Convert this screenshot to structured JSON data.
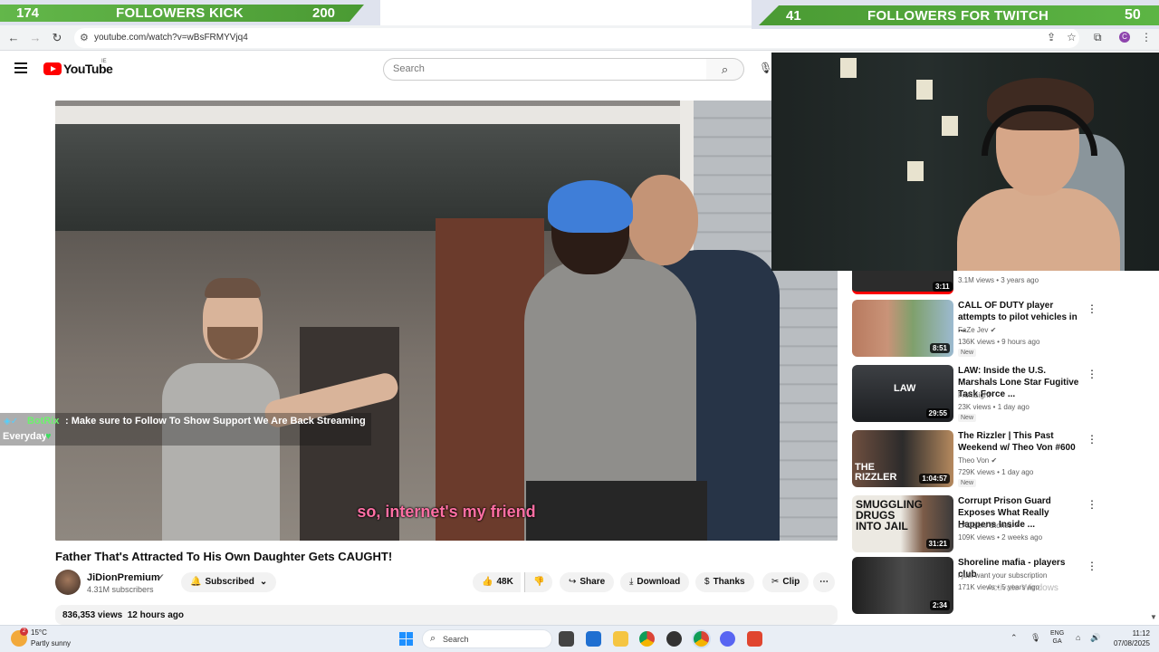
{
  "overlay": {
    "kick": {
      "left_count": "174",
      "label": "FOLLOWERS KICK",
      "right_count": "200"
    },
    "twitch": {
      "left_count": "41",
      "label": "FOLLOWERS FOR TWITCH",
      "right_count": "50"
    }
  },
  "browser": {
    "url": "youtube.com/watch?v=wBsFRMYVjq4",
    "profile_initial": "C",
    "icons": [
      "back-icon",
      "forward-icon",
      "reload-icon",
      "site-info-icon",
      "install-icon",
      "bookmark-star-icon",
      "extensions-icon",
      "menu-dots-icon"
    ]
  },
  "youtube": {
    "logo_text": "YouTube",
    "country_code": "IE",
    "search_placeholder": "Search"
  },
  "player": {
    "subtitle": "so, internet's my friend"
  },
  "chat": {
    "user": "BotRix",
    "message": ": Make sure to Follow To Show Support We Are Back Streaming",
    "message_cont": "Everyday"
  },
  "video": {
    "title": "Father That's Attracted To His Own Daughter Gets CAUGHT!",
    "channel": "JiDionPremium",
    "subscribers": "4.31M subscribers",
    "subscribed_label": "Subscribed",
    "likes": "48K",
    "share_label": "Share",
    "download_label": "Download",
    "thanks_label": "Thanks",
    "clip_label": "Clip",
    "views": "836,353 views",
    "posted": "12 hours ago"
  },
  "recommendations": {
    "partial": {
      "duration": "3:11",
      "meta": "3.1M views • 3 years ago"
    },
    "items": [
      {
        "title": "CALL OF DUTY player attempts to pilot vehicles in ...",
        "channel": "FaZe Jev",
        "meta": "136K views • 9 hours ago",
        "badge": "New",
        "duration": "8:51"
      },
      {
        "title": "LAW: Inside the U.S. Marshals Lone Star Fugitive Task Force ...",
        "channel": "Frontsight",
        "meta": "23K views • 1 day ago",
        "badge": "New",
        "duration": "29:55"
      },
      {
        "title": "The Rizzler | This Past Weekend w/ Theo Von #600",
        "channel": "Theo Von",
        "meta": "729K views • 1 day ago",
        "badge": "New",
        "duration": "1:04:57"
      },
      {
        "title": "Corrupt Prison Guard Exposes What Really Happens Inside ...",
        "channel": "LADbible Stories",
        "meta": "109K views • 2 weeks ago",
        "badge": "",
        "duration": "31:21"
      },
      {
        "title": "Shoreline mafia - players club",
        "channel": "i just want your subscription",
        "meta": "171K views • 5 years ago",
        "badge": "",
        "duration": "2:34"
      }
    ],
    "thumb_texts": [
      "",
      "LAW",
      "THE RIZZLER",
      "SMUGGLING DRUGS INTO JAIL",
      ""
    ]
  },
  "windows": {
    "activate_text": "Activate Windows",
    "temperature": "15°C",
    "condition": "Partly sunny",
    "weather_badge": "2",
    "search_label": "Search",
    "lang_top": "ENG",
    "lang_bottom": "GA",
    "time": "11:12",
    "date": "07/08/2025"
  }
}
